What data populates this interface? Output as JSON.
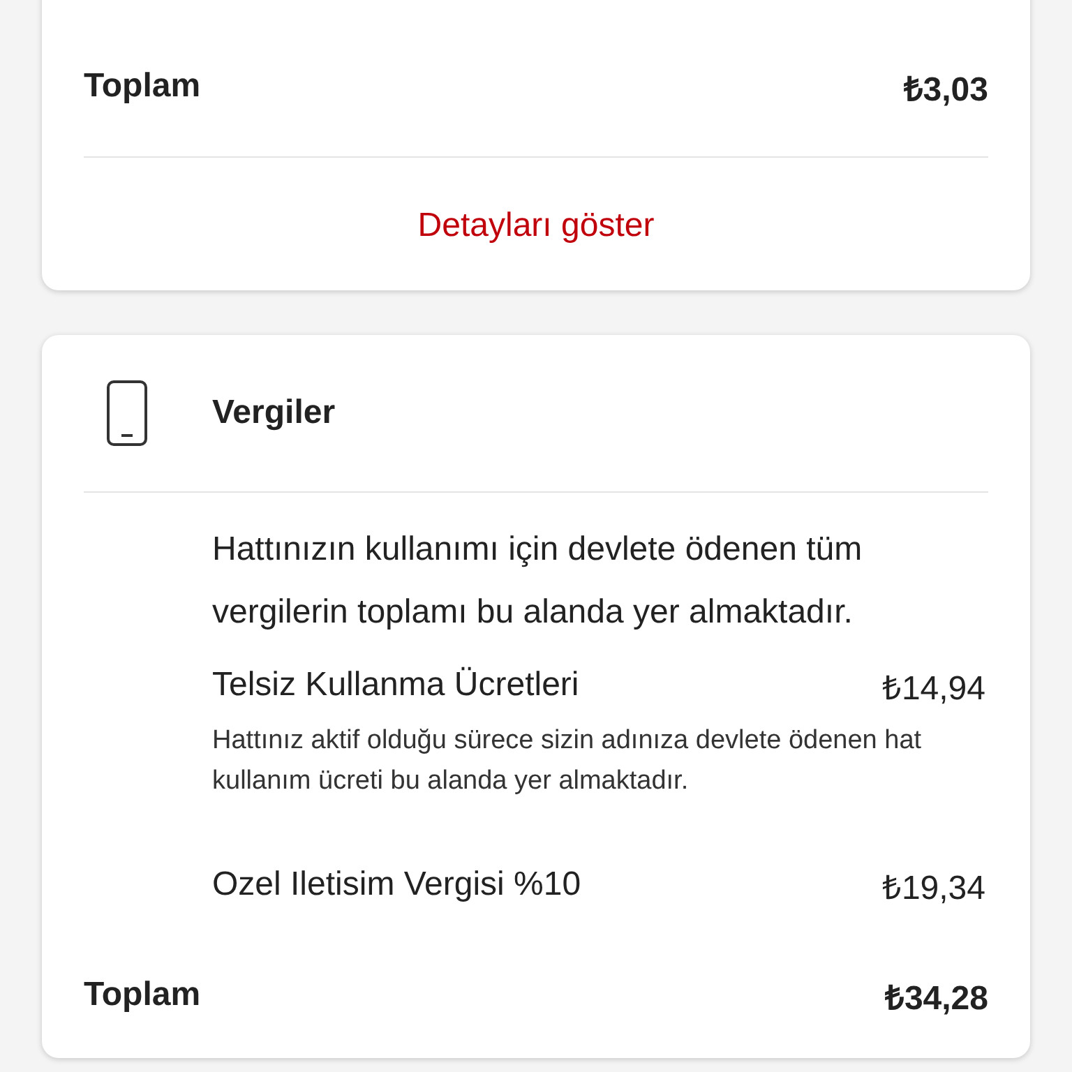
{
  "summary_card": {
    "total_label": "Toplam",
    "total_amount": "₺3,03",
    "details_link": "Detayları göster"
  },
  "taxes_card": {
    "title": "Vergiler",
    "description": "Hattınızın kullanımı için devlete ödenen tüm vergilerin toplamı bu alanda yer almaktadır.",
    "items": [
      {
        "name": "Telsiz Kullanma Ücretleri",
        "amount": "₺14,94",
        "note": "Hattınız aktif olduğu sürece sizin adınıza devlete ödenen hat kullanım ücreti bu alanda yer almaktadır."
      },
      {
        "name": "Ozel Iletisim Vergisi %10",
        "amount": "₺19,34"
      }
    ],
    "total_label": "Toplam",
    "total_amount": "₺34,28"
  }
}
